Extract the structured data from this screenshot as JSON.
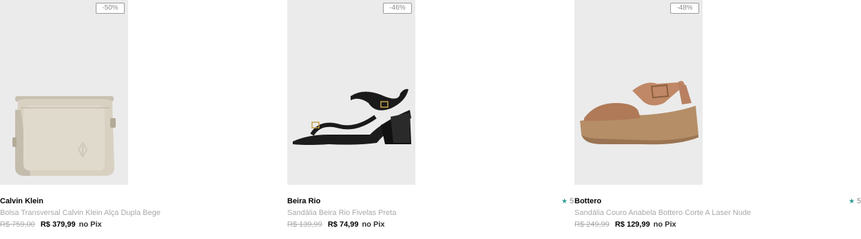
{
  "products": [
    {
      "badge": "-50%",
      "brand": "Calvin Klein",
      "name": "Bolsa Transversal Calvin Klein Alça Dupla Bege",
      "old_price": "R$ 759,00",
      "new_price": "R$ 379,99",
      "pix_label": "no Pix",
      "image_icon": "beige-crossbody-bag-icon"
    },
    {
      "badge": "-46%",
      "brand": "Beira Rio",
      "name": "Sandália Beira Rio Fivelas Preta",
      "old_price": "R$ 139,99",
      "new_price": "R$ 74,99",
      "pix_label": "no Pix",
      "image_icon": "black-heeled-sandal-icon"
    },
    {
      "badge": "-48%",
      "brand": "Bottero",
      "name": "Sandália Couro Anabela Bottero Corte A Laser Nude",
      "old_price": "R$ 249,99",
      "new_price": "R$ 129,99",
      "pix_label": "no Pix",
      "image_icon": "nude-wedge-sandal-icon"
    }
  ],
  "ratings": [
    {
      "value": "5",
      "icon": "star-icon"
    },
    {
      "value": "5",
      "icon": "star-icon"
    }
  ],
  "colors": {
    "star": "#2a9d8f",
    "image_bg": "#ebebeb"
  }
}
